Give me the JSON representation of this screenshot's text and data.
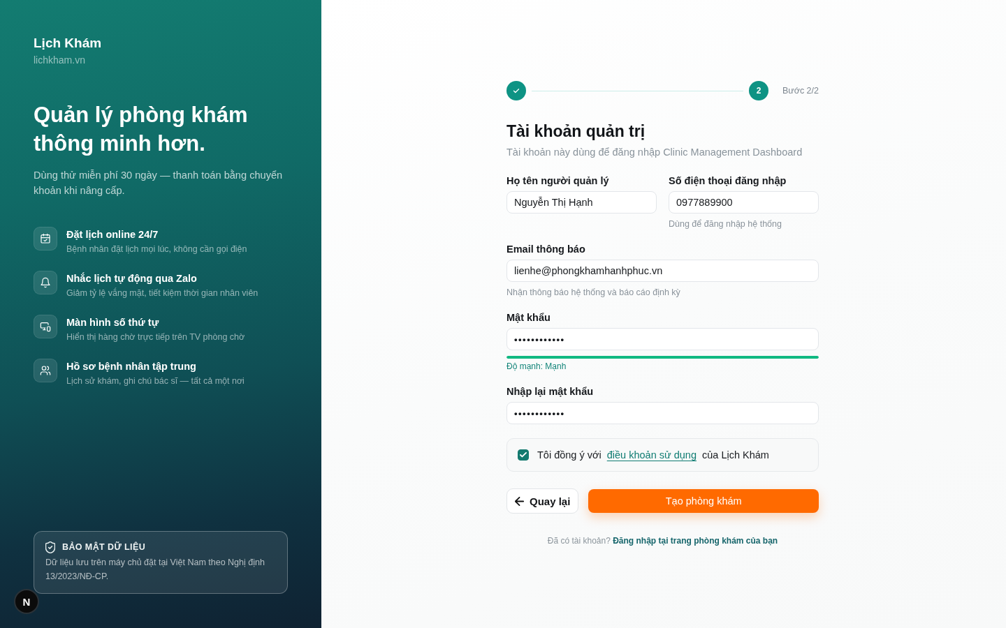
{
  "brand": {
    "name": "Lịch Khám",
    "domain": "lichkham.vn"
  },
  "hero": {
    "title": "Quản lý phòng khám thông minh hơn.",
    "subtitle": "Dùng thử miễn phí 30 ngày — thanh toán bằng chuyển khoản khi nâng cấp."
  },
  "features": [
    {
      "kind": "calendar",
      "title": "Đặt lịch online 24/7",
      "description": "Bệnh nhân đặt lịch mọi lúc, không cần gọi điện"
    },
    {
      "kind": "bell",
      "title": "Nhắc lịch tự động qua Zalo",
      "description": "Giảm tỷ lệ vắng mặt, tiết kiệm thời gian nhân viên"
    },
    {
      "kind": "screen",
      "title": "Màn hình số thứ tự",
      "description": "Hiển thị hàng chờ trực tiếp trên TV phòng chờ"
    },
    {
      "kind": "users",
      "title": "Hồ sơ bệnh nhân tập trung",
      "description": "Lịch sử khám, ghi chú bác sĩ — tất cả một nơi"
    }
  ],
  "security_note": {
    "title": "BẢO MẬT DỮ LIỆU",
    "text": "Dữ liệu lưu trên máy chủ đặt tại Việt Nam theo Nghị định 13/2023/NĐ-CP."
  },
  "dev_indicator": {
    "label": "N"
  },
  "stepper": {
    "steps": [
      {
        "done": true
      },
      {
        "label": "2",
        "done": false
      }
    ],
    "caption": "Bước 2/2"
  },
  "form": {
    "title": "Tài khoản quản trị",
    "subtitle": "Tài khoản này dùng để đăng nhập Clinic Management Dashboard",
    "rows": [
      [
        {
          "kind": "text",
          "label": "Họ tên người quản lý",
          "value": "Nguyễn Thị Hạnh"
        },
        {
          "kind": "text",
          "label": "Số điện thoại đăng nhập",
          "value": "0977889900",
          "hint": "Dùng để đăng nhập hệ thống"
        }
      ],
      [
        {
          "kind": "text",
          "label": "Email thông báo",
          "value": "lienhe@phongkhamhanhphuc.vn",
          "hint": "Nhận thông báo hệ thống và báo cáo định kỳ"
        }
      ],
      [
        {
          "kind": "password",
          "label": "Mật khẩu",
          "value": "••••••••••••",
          "strength": {
            "level": 1,
            "label": "Độ mạnh: Mạnh"
          }
        }
      ],
      [
        {
          "kind": "password",
          "label": "Nhập lại mật khẩu",
          "value": "••••••••••••"
        }
      ]
    ],
    "agreement": {
      "checked": true,
      "text_before": "Tôi đồng ý với",
      "link": "điều khoản sử dụng",
      "text_after": "của Lịch Khám"
    },
    "back_button": "Quay lại",
    "submit_button": "Tạo phòng khám",
    "login_prompt": {
      "text": "Đã có tài khoản?",
      "link": "Đăng nhập tại trang phòng khám của bạn"
    }
  }
}
